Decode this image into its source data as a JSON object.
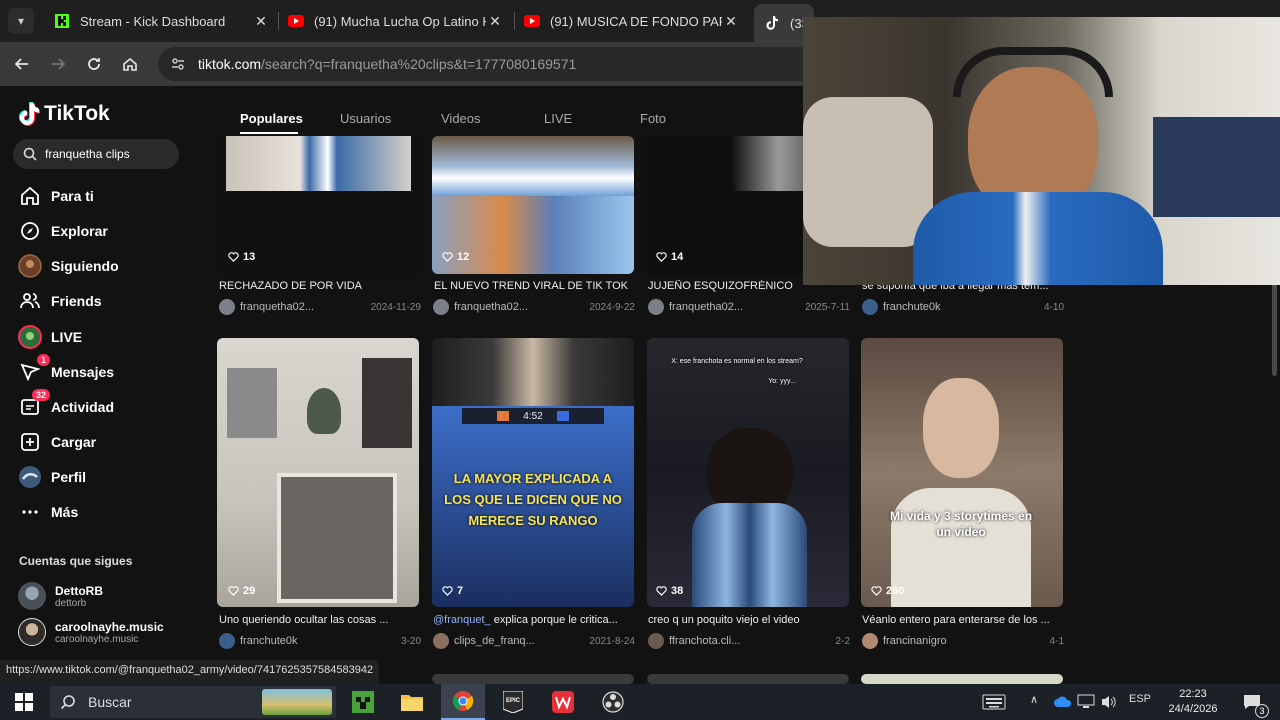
{
  "browser": {
    "tabs": [
      {
        "title": "Stream - Kick Dashboard",
        "icon": "kick-icon"
      },
      {
        "title": "(91) Mucha Lucha Op Latino HD",
        "icon": "youtube-icon"
      },
      {
        "title": "(91) MUSICA DE FONDO PARA",
        "icon": "youtube-icon"
      },
      {
        "title": "(33",
        "icon": "tiktok-icon"
      }
    ],
    "url_host": "tiktok.com",
    "url_path": "/search?q=franquetha%20clips&t=1777080169571",
    "status_url": "https://www.tiktok.com/@franquetha02_army/video/7417625357584583942"
  },
  "sidebar": {
    "logo": "TikTok",
    "search_value": "franquetha clips",
    "nav": [
      {
        "label": "Para ti",
        "icon": "home-icon"
      },
      {
        "label": "Explorar",
        "icon": "compass-icon"
      },
      {
        "label": "Siguiendo",
        "icon": "following-avatar-icon"
      },
      {
        "label": "Friends",
        "icon": "friends-icon"
      },
      {
        "label": "LIVE",
        "icon": "live-icon"
      },
      {
        "label": "Mensajes",
        "icon": "messages-icon",
        "badge": "1"
      },
      {
        "label": "Actividad",
        "icon": "activity-icon",
        "badge": "32"
      },
      {
        "label": "Cargar",
        "icon": "upload-icon"
      },
      {
        "label": "Perfil",
        "icon": "profile-icon"
      },
      {
        "label": "Más",
        "icon": "more-icon"
      }
    ],
    "following_title": "Cuentas que sigues",
    "following": [
      {
        "name": "DettoRB",
        "handle": "dettorb"
      },
      {
        "name": "caroolnayhe.music",
        "handle": "caroolnayhe.music"
      }
    ]
  },
  "tabs": [
    {
      "label": "Populares",
      "active": true
    },
    {
      "label": "Usuarios",
      "active": false
    },
    {
      "label": "Videos",
      "active": false
    },
    {
      "label": "LIVE",
      "active": false
    },
    {
      "label": "Foto",
      "active": false
    }
  ],
  "videos_row1": [
    {
      "likes": "13",
      "caption": "RECHAZADO DE POR VIDA",
      "author": "franquetha02...",
      "date": "2024-11-29"
    },
    {
      "likes": "12",
      "caption": "EL NUEVO TREND VIRAL DE TIK TOK",
      "author": "franquetha02...",
      "date": "2024-9-22"
    },
    {
      "likes": "14",
      "caption": "JUJEÑO ESQUIZOFRÉNICO",
      "author": "franquetha02...",
      "date": "2025-7-11"
    },
    {
      "likes": "",
      "caption": "se suponía que iba a llegar mas tem...",
      "author": "franchute0k",
      "date": "4-10"
    }
  ],
  "videos_row2": [
    {
      "likes": "29",
      "caption": "Uno queriendo ocultar las cosas ...",
      "tag": "",
      "author": "franchute0k",
      "date": "3-20",
      "overlay": ""
    },
    {
      "likes": "7",
      "caption": "explica porque le critica...",
      "tag": "@franquet_",
      "author": "clips_de_franq...",
      "date": "2021-8-24",
      "overlay": "LA MAYOR EXPLICADA A LOS QUE LE DICEN QUE NO MERECE SU RANGO",
      "hud": "4:52"
    },
    {
      "likes": "38",
      "caption": "creo q un poquito viejo el video",
      "tag": "",
      "author": "ffranchota.cli...",
      "date": "2-2",
      "overlay_top": "X: ese franchota es normal en los stream?",
      "overlay_top2": "Yo: yyy..."
    },
    {
      "likes": "260",
      "caption": "Véanlo entero para enterarse de los ...",
      "tag": "",
      "author": "francinanigro",
      "date": "4-1",
      "overlay": "Mi vida y 3 storytimes en un video"
    }
  ],
  "taskbar": {
    "search_placeholder": "Buscar",
    "lang": "ESP",
    "time": "22:23",
    "date": "24/4/2026",
    "notifications": "3"
  },
  "colors": {
    "accent": "#fe2c55",
    "bg": "#121212",
    "cyan": "#25f4ee"
  }
}
